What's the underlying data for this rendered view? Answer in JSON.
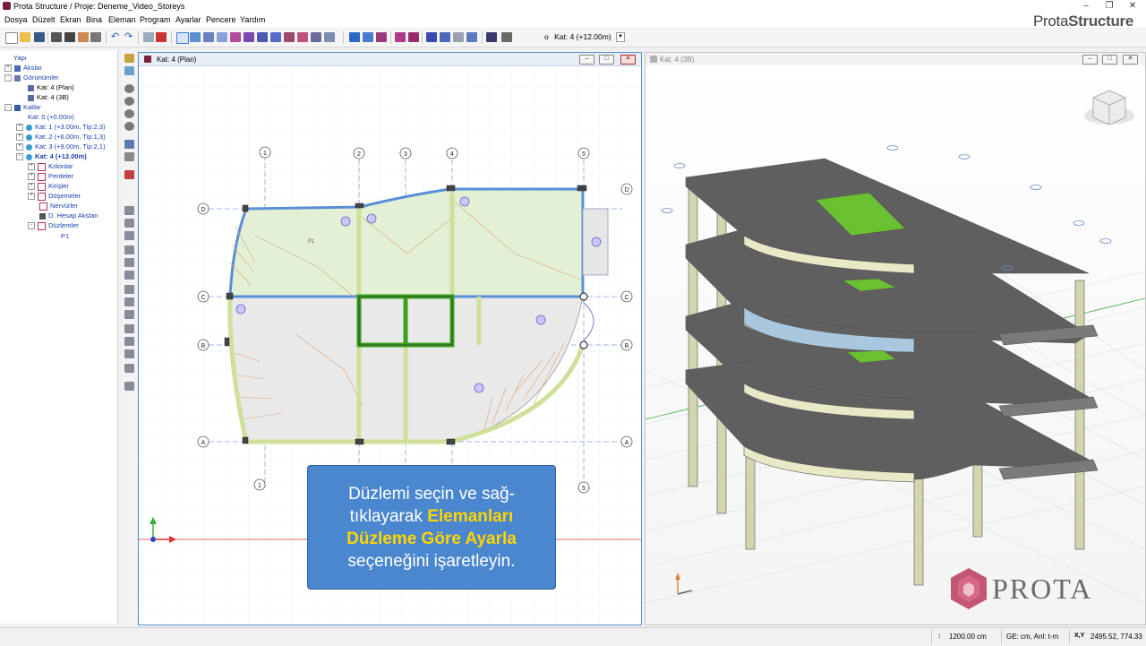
{
  "window": {
    "title": "Prota Structure / Proje: Deneme_Video_Storeys",
    "brand_light": "Prota",
    "brand_bold": "Structure"
  },
  "menu": [
    "Dosya",
    "Düzelt",
    "Ekran",
    "Bina",
    "Eleman",
    "Program",
    "Ayarlar",
    "Pencere",
    "Yardım"
  ],
  "toolbar": {
    "story_prefix": "o",
    "story_value": "Kat: 4 (+12.00m)"
  },
  "tree": {
    "root": "Yapı",
    "items": [
      {
        "label": "Akslar"
      },
      {
        "label": "Görünümler"
      },
      {
        "label": "Kat: 4 (Plan)"
      },
      {
        "label": "Kat: 4 (3B)"
      },
      {
        "label": "Katlar"
      },
      {
        "label": "Kat: 0 (+0.00m)"
      },
      {
        "label": "Kat: 1 (+3.00m, Tip:2,3)"
      },
      {
        "label": "Kat: 2 (+6.00m, Tip:1,3)"
      },
      {
        "label": "Kat: 3 (+9.00m, Tip:2,1)"
      },
      {
        "label": "Kat: 4 (+12.00m)"
      },
      {
        "label": "Kolonlar"
      },
      {
        "label": "Perdeler"
      },
      {
        "label": "Kirişler"
      },
      {
        "label": "Döşemeler"
      },
      {
        "label": "Nervürler"
      },
      {
        "label": "D. Hesap Aksları"
      },
      {
        "label": "Düzlemler"
      },
      {
        "label": "P1"
      }
    ]
  },
  "plan_window": {
    "title": "Kat: 4 (Plan)",
    "slab_label": "P1",
    "axis_numbers": [
      "1",
      "2",
      "3",
      "4",
      "5"
    ],
    "axis_letters": [
      "A",
      "B",
      "C",
      "D"
    ]
  },
  "view3d_window": {
    "title": "Kat: 4 (3B)"
  },
  "tooltip": {
    "line1": "Düzlemi seçin ve sağ-",
    "line2_pre": "tıklayarak ",
    "line2_hl": "Elemanları",
    "line3_hl": "Düzleme Göre Ayarla",
    "line4": "seçeneğini işaretleyin."
  },
  "status": {
    "length": "1200.00 cm",
    "units": "GE: cm, Anl: t-m",
    "coord_label": "X,Y",
    "coords": "2495.52, 774.33"
  },
  "logo": {
    "word": "PROTA"
  },
  "colors": {
    "accent": "#4b87cf",
    "highlight": "#ffd400",
    "slab": "#e3f0d5"
  }
}
